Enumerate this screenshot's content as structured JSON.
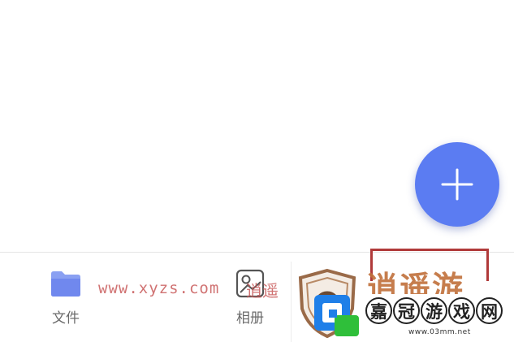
{
  "fab": {
    "icon": "plus-icon",
    "color": "#5b7cf2"
  },
  "tabbar": {
    "tabs": [
      {
        "label": "文件",
        "icon": "folder-icon",
        "icon_color": "#7f97f0"
      },
      {
        "label": "相册",
        "icon": "album-icon",
        "icon_color": "#555555"
      }
    ]
  },
  "watermarks": {
    "url_text": "www.xyzs.com",
    "url_suffix": "逍遥",
    "brand_cut": "逍遥游",
    "logo_chars": [
      "嘉",
      "冠",
      "游",
      "戏",
      "网"
    ],
    "site": "www.03mm.net"
  }
}
